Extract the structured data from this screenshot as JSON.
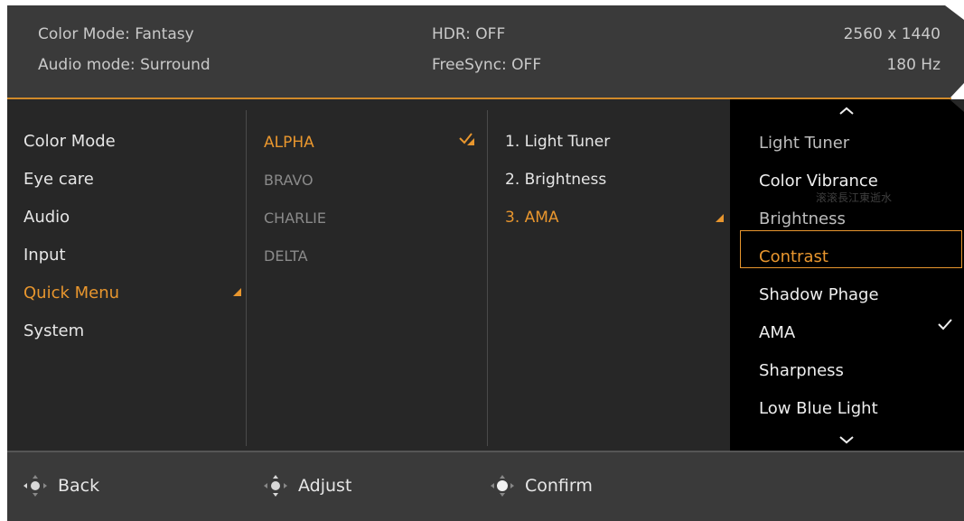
{
  "status": {
    "color_mode": "Color Mode: Fantasy",
    "audio_mode": "Audio mode: Surround",
    "hdr": "HDR: OFF",
    "freesync": "FreeSync: OFF",
    "resolution": "2560 x 1440",
    "refresh": "180 Hz"
  },
  "main_menu": {
    "items": [
      "Color Mode",
      "Eye care",
      "Audio",
      "Input",
      "Quick Menu",
      "System"
    ],
    "active": "Quick Menu"
  },
  "profiles": {
    "items": [
      "ALPHA",
      "BRAVO",
      "CHARLIE",
      "DELTA"
    ],
    "active": "ALPHA"
  },
  "quick_menu": {
    "items": [
      "1.  Light Tuner",
      "2. Brightness",
      "3. AMA"
    ],
    "active": "3. AMA"
  },
  "options": {
    "items": [
      "Light Tuner",
      "Color Vibrance",
      "Brightness",
      "Contrast",
      "Shadow Phage",
      "AMA",
      "Sharpness",
      "Low Blue Light"
    ],
    "highlighted": "Contrast",
    "checked": "AMA",
    "watermark": "滚滚長江東逝水"
  },
  "footer": {
    "back": "Back",
    "adjust": "Adjust",
    "confirm": "Confirm"
  },
  "colors": {
    "accent": "#e8962e",
    "header_bg": "#3a3a3a",
    "body_bg": "#272727",
    "panel_bg": "#000000"
  },
  "icons": [
    "check-icon",
    "chevron-up-icon",
    "chevron-down-icon",
    "joystick-icon",
    "submenu-arrow-icon"
  ]
}
